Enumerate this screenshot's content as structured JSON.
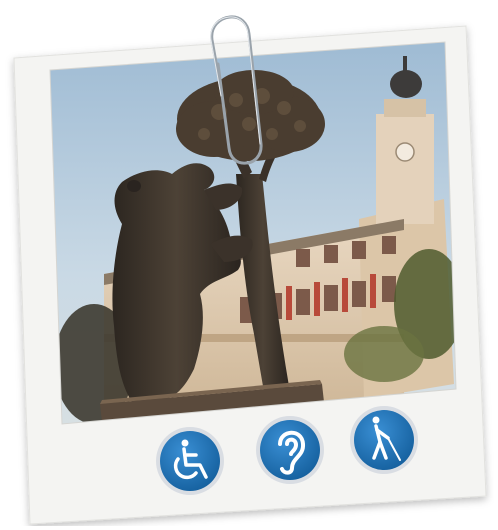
{
  "photo": {
    "subject": "bear-and-strawberry-tree-statue"
  },
  "accessibility_icons": [
    {
      "name": "wheelchair-icon"
    },
    {
      "name": "hearing-icon"
    },
    {
      "name": "visually-impaired-icon"
    }
  ],
  "colors": {
    "badge_blue": "#1f73b8",
    "badge_ring": "#d9dde3",
    "frame": "#f4f4f2",
    "sky": "#aec7dc"
  }
}
